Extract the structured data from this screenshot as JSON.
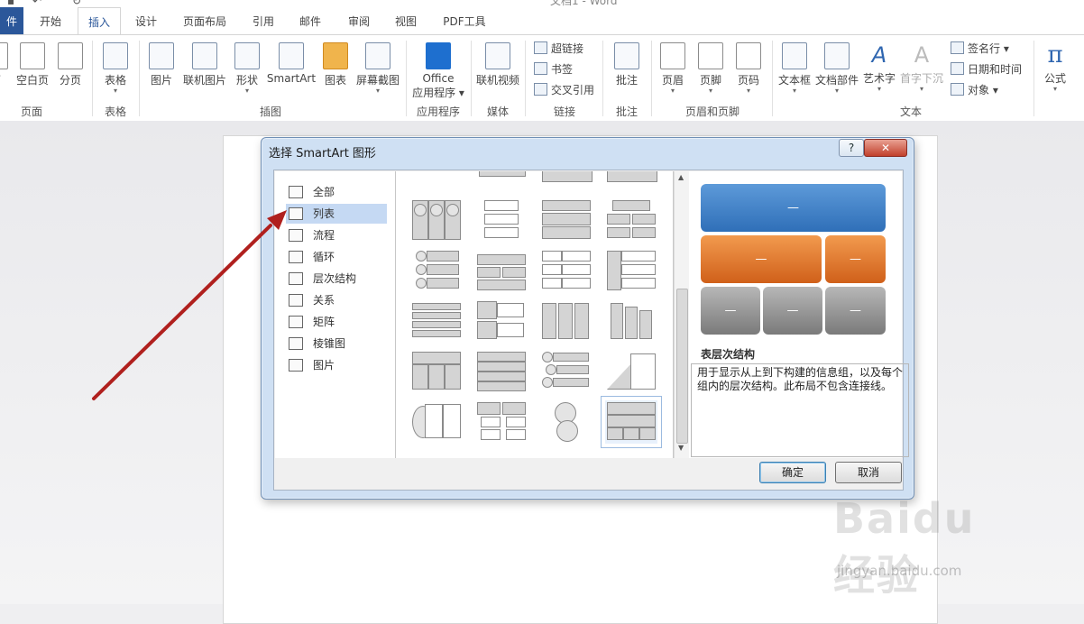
{
  "title_bar": {
    "doc_title": "文档1 - Word"
  },
  "tabs": [
    {
      "label": "件",
      "file": true
    },
    {
      "label": "开始"
    },
    {
      "label": "插入",
      "active": true
    },
    {
      "label": "设计"
    },
    {
      "label": "页面布局"
    },
    {
      "label": "引用"
    },
    {
      "label": "邮件"
    },
    {
      "label": "审阅"
    },
    {
      "label": "视图"
    },
    {
      "label": "PDF工具"
    }
  ],
  "ribbon": {
    "pages_group": {
      "label": "页面",
      "buttons": [
        "面",
        "空白页",
        "分页"
      ]
    },
    "tables_group": {
      "label": "表格",
      "buttons": [
        "表格"
      ]
    },
    "illustrations_group": {
      "label": "插图",
      "buttons": [
        "图片",
        "联机图片",
        "形状",
        "SmartArt",
        "图表",
        "屏幕截图"
      ]
    },
    "apps_group": {
      "label": "应用程序",
      "buttons": [
        "Office",
        "应用程序"
      ]
    },
    "media_group": {
      "label": "媒体",
      "buttons": [
        "联机视频"
      ]
    },
    "links_group": {
      "label": "链接",
      "buttons": [
        "超链接",
        "书签",
        "交叉引用"
      ]
    },
    "comments_group": {
      "label": "批注",
      "buttons": [
        "批注"
      ]
    },
    "header_footer_group": {
      "label": "页眉和页脚",
      "buttons": [
        "页眉",
        "页脚",
        "页码"
      ]
    },
    "text_group": {
      "label": "文本",
      "buttons": [
        "文本框",
        "文档部件",
        "艺术字",
        "首字下沉",
        "签名行",
        "日期和时间",
        "对象"
      ]
    },
    "symbols_group": {
      "buttons": [
        "公式"
      ]
    }
  },
  "dialog": {
    "title": "选择 SmartArt 图形",
    "help": "?",
    "categories": [
      {
        "label": "全部",
        "icon": "all-icon"
      },
      {
        "label": "列表",
        "icon": "list-icon",
        "selected": true
      },
      {
        "label": "流程",
        "icon": "process-icon"
      },
      {
        "label": "循环",
        "icon": "cycle-icon"
      },
      {
        "label": "层次结构",
        "icon": "hierarchy-icon"
      },
      {
        "label": "关系",
        "icon": "relationship-icon"
      },
      {
        "label": "矩阵",
        "icon": "matrix-icon"
      },
      {
        "label": "棱锥图",
        "icon": "pyramid-icon"
      },
      {
        "label": "图片",
        "icon": "picture-icon"
      }
    ],
    "preview": {
      "dash": "—",
      "name": "表层次结构",
      "description": "用于显示从上到下构建的信息组，以及每个组内的层次结构。此布局不包含连接线。"
    },
    "ok_label": "确定",
    "cancel_label": "取消"
  },
  "watermark": {
    "logo": "Baidu经验",
    "url": "jingyan.baidu.com"
  },
  "colors": {
    "file_tab": "#2b579a",
    "preview_blue": "#3f7fc8",
    "preview_orange": "#e0741d",
    "preview_gray": "#8a8a8a",
    "arrow": "#b0201e"
  }
}
